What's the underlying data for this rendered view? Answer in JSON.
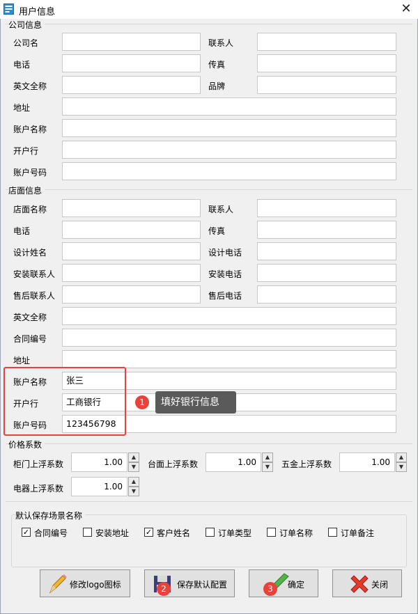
{
  "window": {
    "title": "用户信息",
    "close_glyph": "✕"
  },
  "company": {
    "title": "公司信息",
    "name_label": "公司名",
    "contact_label": "联系人",
    "phone_label": "电话",
    "fax_label": "传真",
    "english_name_label": "英文全称",
    "brand_label": "品牌",
    "address_label": "地址",
    "account_name_label": "账户名称",
    "bank_label": "开户行",
    "account_number_label": "账户号码",
    "values": {
      "name": "",
      "contact": "",
      "phone": "",
      "fax": "",
      "english_name": "",
      "brand": "",
      "address": "",
      "account_name": "",
      "bank": "",
      "account_number": ""
    }
  },
  "store": {
    "title": "店面信息",
    "name_label": "店面名称",
    "contact_label": "联系人",
    "phone_label": "电话",
    "fax_label": "传真",
    "designer_label": "设计姓名",
    "designer_phone_label": "设计电话",
    "install_contact_label": "安装联系人",
    "install_phone_label": "安装电话",
    "aftersale_contact_label": "售后联系人",
    "aftersale_phone_label": "售后电话",
    "english_name_label": "英文全称",
    "contract_no_label": "合同编号",
    "address_label": "地址",
    "account_name_label": "账户名称",
    "account_name_value": "张三",
    "bank_label": "开户行",
    "bank_value": "工商银行",
    "account_number_label": "账户号码",
    "account_number_value": "123456798"
  },
  "price": {
    "title": "价格系数",
    "cabinet_door_label": "柜门上浮系数",
    "cabinet_door_value": "1.00",
    "countertop_label": "台面上浮系数",
    "countertop_value": "1.00",
    "hardware_label": "五金上浮系数",
    "hardware_value": "1.00",
    "appliance_label": "电器上浮系数",
    "appliance_value": "1.00",
    "up_arrow": "▲",
    "down_arrow": "▼"
  },
  "save_scene": {
    "title": "默认保存场景名称",
    "options": [
      {
        "label": "合同编号",
        "checked": true
      },
      {
        "label": "安装地址",
        "checked": false
      },
      {
        "label": "客户姓名",
        "checked": true
      },
      {
        "label": "订单类型",
        "checked": false
      },
      {
        "label": "订单名称",
        "checked": false
      },
      {
        "label": "订单备注",
        "checked": false
      }
    ],
    "check_glyph": "✓"
  },
  "buttons": {
    "logo": "修改logo图标",
    "save_default": "保存默认配置",
    "ok": "确定",
    "close": "关闭"
  },
  "annotations": {
    "tooltip": "填好银行信息",
    "step1": "1",
    "step2": "2",
    "step3": "3",
    "highlight_color": "#e94040"
  }
}
